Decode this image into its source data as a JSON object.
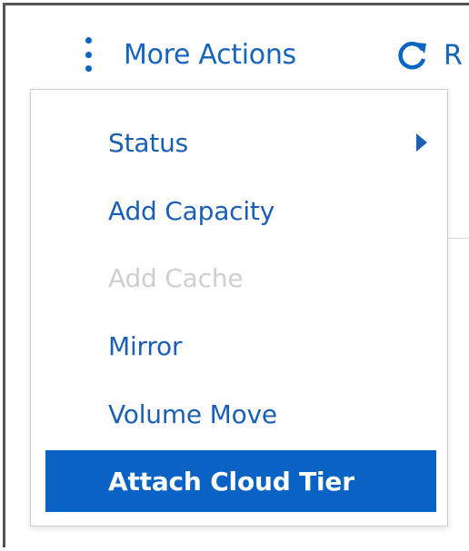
{
  "toolbar": {
    "more_actions_label": "More Actions",
    "refresh_label": "R"
  },
  "menu": {
    "items": [
      {
        "label": "Status",
        "state": "enabled",
        "has_submenu": true
      },
      {
        "label": "Add Capacity",
        "state": "enabled"
      },
      {
        "label": "Add Cache",
        "state": "disabled"
      },
      {
        "label": "Mirror",
        "state": "enabled"
      },
      {
        "label": "Volume Move",
        "state": "enabled"
      },
      {
        "label": "Attach Cloud Tier",
        "state": "highlighted"
      }
    ]
  },
  "colors": {
    "link_blue": "#1565c0",
    "highlight_blue": "#0a62c4",
    "disabled_gray": "#cfcfcf"
  },
  "icons": [
    "kebab-vertical-icon",
    "refresh-icon",
    "submenu-arrow-icon"
  ]
}
